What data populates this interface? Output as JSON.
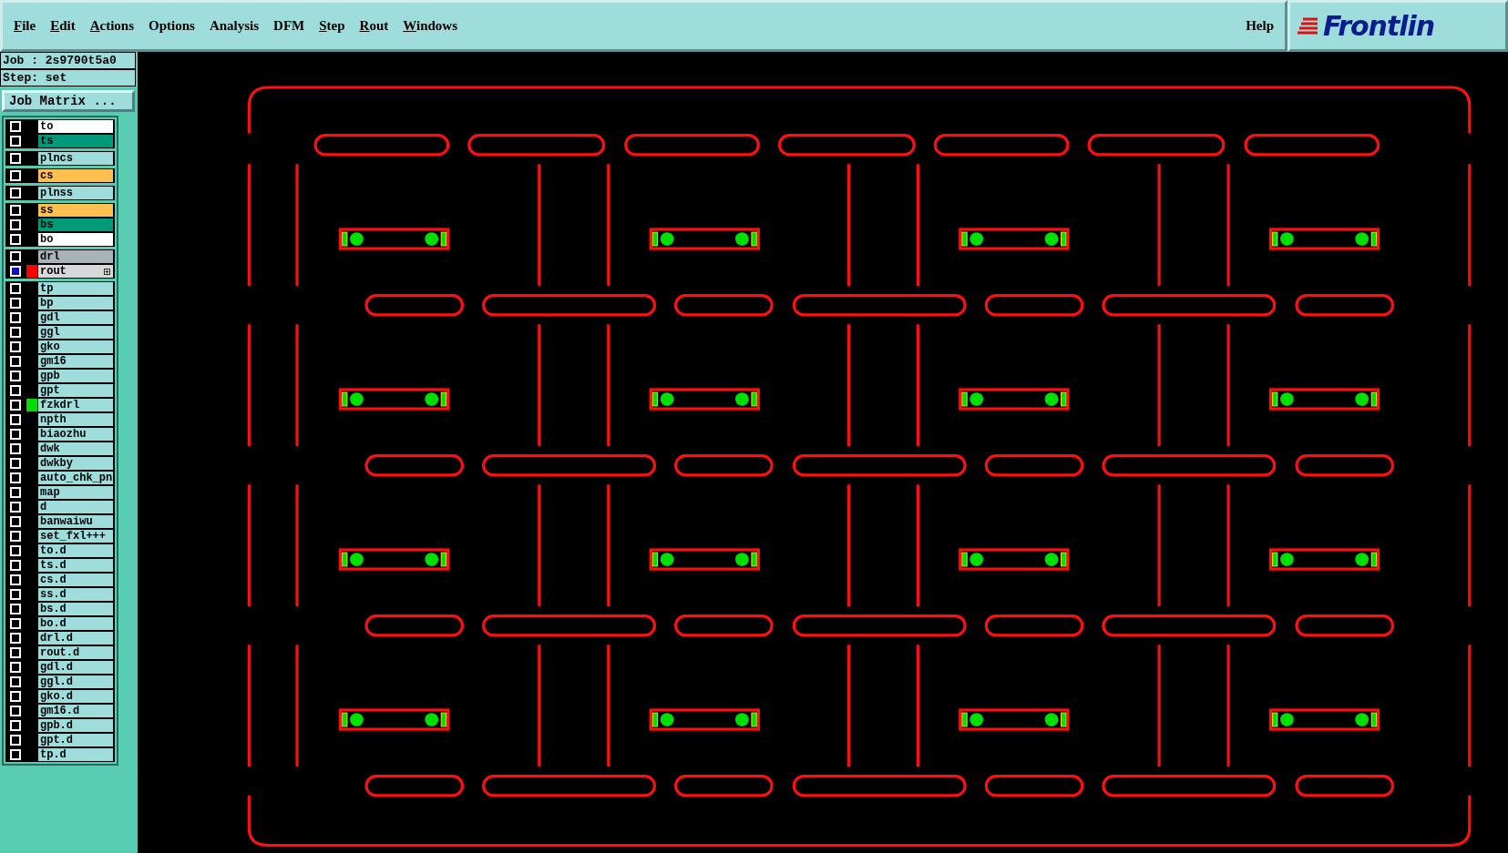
{
  "menu": {
    "items": [
      {
        "label": "File",
        "mnemonic": true
      },
      {
        "label": "Edit",
        "mnemonic": true
      },
      {
        "label": "Actions",
        "mnemonic": true
      },
      {
        "label": "Options",
        "mnemonic": false
      },
      {
        "label": "Analysis",
        "mnemonic": false
      },
      {
        "label": "DFM",
        "mnemonic": false
      },
      {
        "label": "Step",
        "mnemonic": true
      },
      {
        "label": "Rout",
        "mnemonic": true
      },
      {
        "label": "Windows",
        "mnemonic": true
      }
    ],
    "help": "Help"
  },
  "logo": "Frontlin",
  "job": {
    "job_label": "Job : 2s9790t5a0",
    "step_label": "Step: set",
    "matrix_button": "Job Matrix ..."
  },
  "layer_groups": [
    {
      "layers": [
        {
          "name": "to",
          "kind": "paste",
          "affected": false
        },
        {
          "name": "ts",
          "kind": "mask",
          "affected": false
        }
      ]
    },
    {
      "layers": [
        {
          "name": "plncs",
          "kind": "power",
          "affected": false
        }
      ]
    },
    {
      "layers": [
        {
          "name": "cs",
          "kind": "signal",
          "affected": false
        }
      ]
    },
    {
      "layers": [
        {
          "name": "plnss",
          "kind": "power",
          "affected": false
        }
      ]
    },
    {
      "layers": [
        {
          "name": "ss",
          "kind": "signal",
          "affected": false
        },
        {
          "name": "bs",
          "kind": "mask",
          "affected": false
        },
        {
          "name": "bo",
          "kind": "paste",
          "affected": false
        }
      ]
    },
    {
      "layers": [
        {
          "name": "drl",
          "kind": "drill",
          "affected": false
        },
        {
          "name": "rout",
          "kind": "rout",
          "affected": true,
          "color": "#ff0000"
        }
      ]
    },
    {
      "layers": [
        {
          "name": "tp",
          "kind": "misc",
          "affected": false
        },
        {
          "name": "bp",
          "kind": "misc",
          "affected": false
        },
        {
          "name": "gdl",
          "kind": "misc",
          "affected": false
        },
        {
          "name": "ggl",
          "kind": "misc",
          "affected": false
        },
        {
          "name": "gko",
          "kind": "misc",
          "affected": false
        },
        {
          "name": "gm16",
          "kind": "misc",
          "affected": false
        },
        {
          "name": "gpb",
          "kind": "misc",
          "affected": false
        },
        {
          "name": "gpt",
          "kind": "misc",
          "affected": false
        },
        {
          "name": "fzkdrl",
          "kind": "misc",
          "affected": false,
          "color": "#00dd00"
        },
        {
          "name": "npth",
          "kind": "misc",
          "affected": false
        },
        {
          "name": "biaozhu",
          "kind": "misc",
          "affected": false
        },
        {
          "name": "dwk",
          "kind": "misc",
          "affected": false
        },
        {
          "name": "dwkby",
          "kind": "misc",
          "affected": false
        },
        {
          "name": "auto_chk_pn",
          "kind": "misc",
          "affected": false
        },
        {
          "name": "map",
          "kind": "misc",
          "affected": false
        },
        {
          "name": "d",
          "kind": "misc",
          "affected": false
        },
        {
          "name": "banwaiwu",
          "kind": "misc",
          "affected": false
        },
        {
          "name": "set_fxl+++",
          "kind": "misc",
          "affected": false
        },
        {
          "name": "to.d",
          "kind": "misc",
          "affected": false
        },
        {
          "name": "ts.d",
          "kind": "misc",
          "affected": false
        },
        {
          "name": "cs.d",
          "kind": "misc",
          "affected": false
        },
        {
          "name": "ss.d",
          "kind": "misc",
          "affected": false
        },
        {
          "name": "bs.d",
          "kind": "misc",
          "affected": false
        },
        {
          "name": "bo.d",
          "kind": "misc",
          "affected": false
        },
        {
          "name": "drl.d",
          "kind": "misc",
          "affected": false
        },
        {
          "name": "rout.d",
          "kind": "misc",
          "affected": false
        },
        {
          "name": "gdl.d",
          "kind": "misc",
          "affected": false
        },
        {
          "name": "ggl.d",
          "kind": "misc",
          "affected": false
        },
        {
          "name": "gko.d",
          "kind": "misc",
          "affected": false
        },
        {
          "name": "gm16.d",
          "kind": "misc",
          "affected": false
        },
        {
          "name": "gpb.d",
          "kind": "misc",
          "affected": false
        },
        {
          "name": "gpt.d",
          "kind": "misc",
          "affected": false
        },
        {
          "name": "tp.d",
          "kind": "misc",
          "affected": false
        }
      ]
    }
  ]
}
